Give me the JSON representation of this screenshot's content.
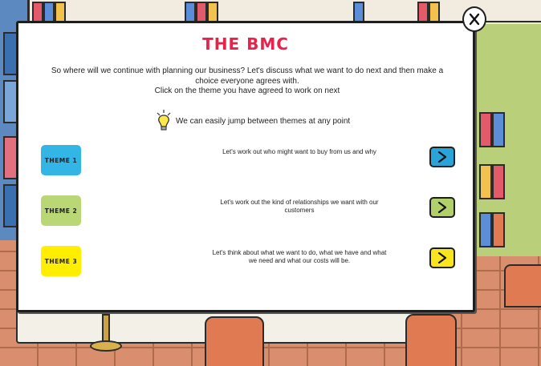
{
  "title": "THE BMC",
  "intro_lines": [
    "So where will we continue with planning our business? Let's discuss what we want to do next and then make a",
    "choice everyone agrees with.",
    "Click on the theme you have agreed to work on next"
  ],
  "tip": "We can easily jump between themes at any point",
  "themes": [
    {
      "label": "THEME 1",
      "description": "Let's work out who might want to buy from us and why",
      "color": "#33b6e6",
      "arrow_color": "#2aa3d8"
    },
    {
      "label": "THEME 2",
      "description": "Let's work out the kind of relationships we want with our customers",
      "color": "#b9d774",
      "arrow_color": "#b2d06a"
    },
    {
      "label": "THEME 3",
      "description": "Let's think about what we want to do, what we have and what we need and what our costs will be.",
      "color": "#ffee00",
      "arrow_color": "#f9e51d"
    }
  ],
  "icons": {
    "close": "close-icon",
    "arrow": "chevron-right-icon",
    "tip": "lightbulb-icon"
  },
  "colors": {
    "title": "#e8224a"
  }
}
